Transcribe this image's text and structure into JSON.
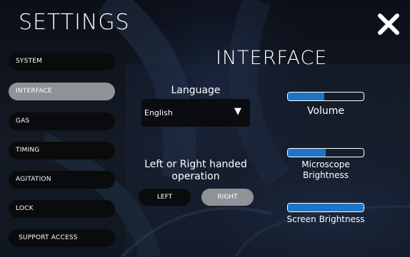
{
  "header": {
    "title": "SETTINGS",
    "close_icon": "close-icon"
  },
  "sidebar": {
    "items": [
      {
        "label": "SYSTEM",
        "active": false
      },
      {
        "label": "INTERFACE",
        "active": true
      },
      {
        "label": "GAS",
        "active": false
      },
      {
        "label": "TIMING",
        "active": false
      },
      {
        "label": "AGITATION",
        "active": false
      },
      {
        "label": "LOCK",
        "active": false
      },
      {
        "label": "SUPPORT ACCESS",
        "active": false
      }
    ]
  },
  "main": {
    "section_title": "INTERFACE",
    "language": {
      "label": "Language",
      "selected": "English",
      "caret_icon": "triangle-down-icon"
    },
    "handedness": {
      "label_line1": "Left or Right handed",
      "label_line2": "operation",
      "left_label": "LEFT",
      "right_label": "RIGHT",
      "selected": "RIGHT"
    },
    "volume": {
      "label": "Volume",
      "level": 0.48
    },
    "microscope_brightness": {
      "label_line1": "Microscope",
      "label_line2": "Brightness",
      "level": 0.5
    },
    "screen_brightness": {
      "label": "Screen Brightness",
      "level": 1.0
    }
  },
  "colors": {
    "accent": "#1f75c4",
    "active_button": "#8f9398",
    "button_bg": "#0a0b0d"
  }
}
